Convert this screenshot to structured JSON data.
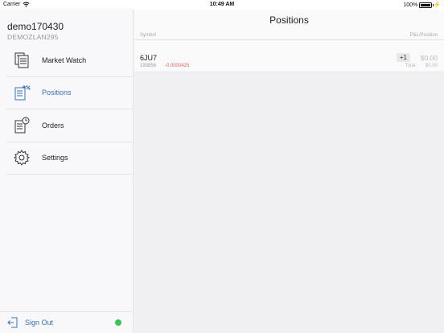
{
  "status_bar": {
    "carrier": "Carrier",
    "time": "10:49 AM",
    "battery": "100%"
  },
  "sidebar": {
    "account_name": "demo170430",
    "account_login": "DEMOZLAN295",
    "items": [
      {
        "label": "Market Watch",
        "icon": "market-watch-icon"
      },
      {
        "label": "Positions",
        "icon": "positions-icon",
        "active": true
      },
      {
        "label": "Orders",
        "icon": "orders-icon"
      },
      {
        "label": "Settings",
        "icon": "gear-icon"
      }
    ],
    "sign_out_label": "Sign Out"
  },
  "main": {
    "title": "Positions",
    "columns": {
      "symbol": "Symbol",
      "pl": "P&L/Position"
    },
    "positions": [
      {
        "symbol": "6JU7",
        "ticket": "193856",
        "change": "-0.0000425",
        "quantity": "+1",
        "pl": "$0.00",
        "total_label": "Total:",
        "total_value": "$0.00"
      }
    ]
  },
  "colors": {
    "accent": "#3a6fb5",
    "negative": "#e06060",
    "connected": "#3cc35a"
  }
}
